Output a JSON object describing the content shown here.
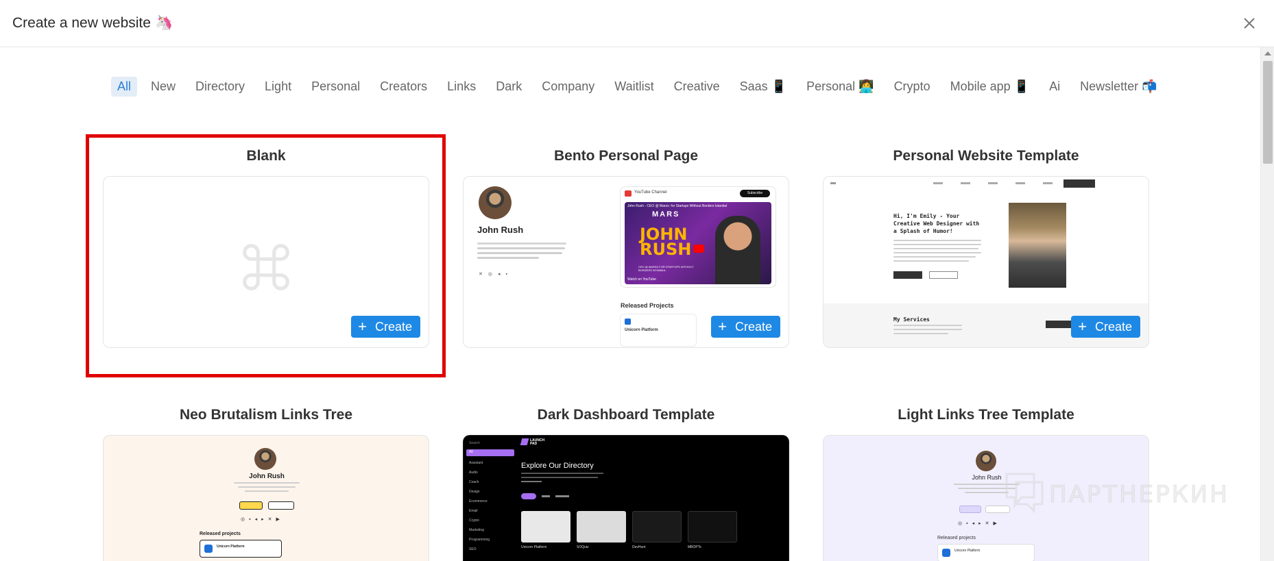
{
  "header": {
    "title": "Create a new website",
    "emoji": "🦄"
  },
  "filters": [
    {
      "label": "All",
      "active": true
    },
    {
      "label": "New"
    },
    {
      "label": "Directory"
    },
    {
      "label": "Light"
    },
    {
      "label": "Personal"
    },
    {
      "label": "Creators"
    },
    {
      "label": "Links"
    },
    {
      "label": "Dark"
    },
    {
      "label": "Company"
    },
    {
      "label": "Waitlist"
    },
    {
      "label": "Creative"
    },
    {
      "label": "Saas 📱"
    },
    {
      "label": "Personal 👩‍💻"
    },
    {
      "label": "Crypto"
    },
    {
      "label": "Mobile app 📱"
    },
    {
      "label": "Ai"
    },
    {
      "label": "Newsletter 📬"
    }
  ],
  "templates": [
    {
      "title": "Blank",
      "create_label": "Create"
    },
    {
      "title": "Bento Personal Page",
      "create_label": "Create"
    },
    {
      "title": "Personal Website Template",
      "create_label": "Create"
    },
    {
      "title": "Neo Brutalism Links Tree"
    },
    {
      "title": "Dark Dashboard Template"
    },
    {
      "title": "Light Links Tree Template"
    }
  ],
  "previews": {
    "bento": {
      "name": "John Rush",
      "video_channel": "YouTube Channel",
      "subscribe": "Subscribe",
      "video_title": "John Rush - CEO @ Marsx: for Startups Without Borders Istanbul",
      "thumb_brand": "MARS",
      "thumb_big": "JOHN RUSH",
      "thumb_sub": "CEO @ MARSX FOR STARTUPS WITHOUT BORDERS ISTANBUL",
      "watch_on": "Watch on YouTube",
      "released": "Released Projects",
      "project": "Unicorn Platform"
    },
    "personal": {
      "headline": "Hi, I'm Emily - Your Creative Web Designer with a Splash of Humor!",
      "services": "My Services"
    },
    "neo": {
      "name": "John Rush",
      "released": "Released projects",
      "project": "Unicorn Platform"
    },
    "dark": {
      "brand": "LAUNCH PAD",
      "heading": "Explore Our Directory",
      "search": "Search",
      "sidebar": [
        "All",
        "Assistant",
        "Audio",
        "Coach",
        "Design",
        "Ecommerce",
        "Email",
        "Crypto",
        "Marketing",
        "Programming",
        "SEO"
      ],
      "items": [
        "Unicorn Platform",
        "SOQuiz",
        "DevHunt",
        "MBOPTs"
      ]
    },
    "light": {
      "name": "John Rush",
      "released": "Released projects",
      "project": "Unicorn Platform"
    }
  },
  "watermark": "ПАРТНЕРКИН"
}
